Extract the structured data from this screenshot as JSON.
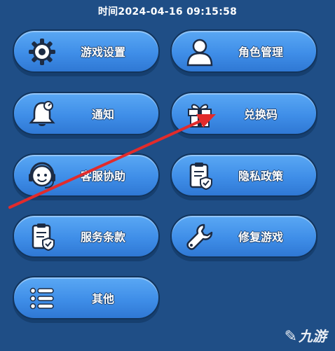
{
  "header": {
    "timestamp": "时间2024-04-16 09:15:58"
  },
  "menu": {
    "game_settings": "游戏设置",
    "role_management": "角色管理",
    "notice": "通知",
    "redeem_code": "兑换码",
    "customer_service": "客服协助",
    "privacy_policy": "隐私政策",
    "terms_of_service": "服务条款",
    "repair_game": "修复游戏",
    "other": "其他"
  },
  "icons": {
    "game_settings": "gear-icon",
    "role_management": "user-icon",
    "notice": "bell-icon",
    "redeem_code": "gift-icon",
    "customer_service": "headset-icon",
    "privacy_policy": "shield-document-icon",
    "terms_of_service": "shield-document-icon",
    "repair_game": "wrench-icon",
    "other": "list-icon"
  },
  "colors": {
    "background": "#1f4e86",
    "button": "#3f8ee8",
    "button_border": "#12345c",
    "arrow": "#e22b2b"
  },
  "watermark": {
    "text": "九游"
  }
}
